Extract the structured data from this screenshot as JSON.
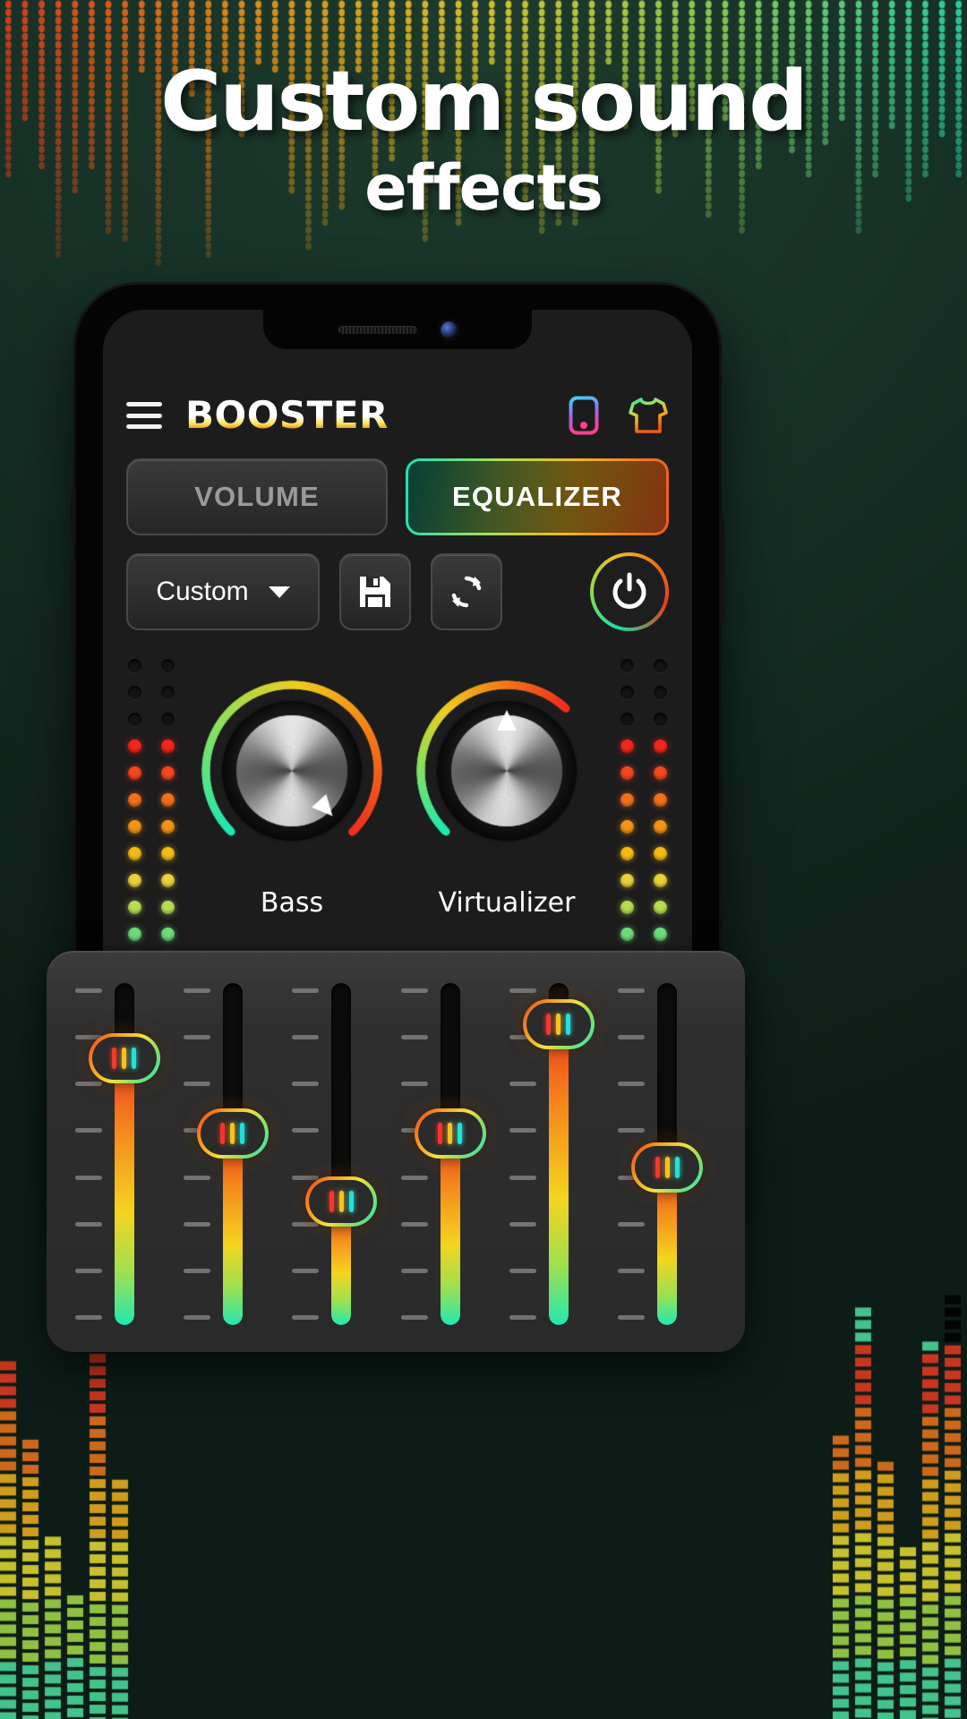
{
  "hero": {
    "line1": "Custom sound",
    "line2": "effects"
  },
  "app": {
    "brand": "BOOSTER",
    "menu_icon": "hamburger-menu-icon",
    "device_icon": "device-phone-icon",
    "theme_icon": "tshirt-theme-icon",
    "tabs": [
      {
        "label": "VOLUME",
        "active": false
      },
      {
        "label": "EQUALIZER",
        "active": true
      }
    ],
    "preset": {
      "value": "Custom",
      "caret_icon": "chevron-down-icon"
    },
    "actions": [
      {
        "name": "save-preset-button",
        "icon": "floppy-save-icon"
      },
      {
        "name": "reset-preset-button",
        "icon": "refresh-reset-icon"
      }
    ],
    "power": {
      "icon": "power-icon",
      "on": true
    },
    "knobs": [
      {
        "label": "Bass",
        "value": 78,
        "pointer_deg": 138
      },
      {
        "label": "Virtualizer",
        "value": 50,
        "pointer_deg": 0
      }
    ],
    "led_meters": {
      "off_count": 3,
      "on_colors": [
        "#f4261c",
        "#f4481c",
        "#f4701c",
        "#f59418",
        "#f5bb15",
        "#ead23a",
        "#b7dd52",
        "#6fe07d",
        "#38e6b2",
        "#16e8d8"
      ]
    },
    "equalizer": {
      "bands": [
        {
          "name": "band-1",
          "value": 78
        },
        {
          "name": "band-2",
          "value": 56
        },
        {
          "name": "band-3",
          "value": 36
        },
        {
          "name": "band-4",
          "value": 56
        },
        {
          "name": "band-5",
          "value": 88
        },
        {
          "name": "band-6",
          "value": 46
        }
      ],
      "tick_count": 8,
      "thumb_bar_colors": [
        "#f2382a",
        "#f5c21e",
        "#22e0d8"
      ]
    }
  },
  "colors": {
    "accent_cyan": "#16e0b8",
    "accent_green": "#a6e05a",
    "accent_yellow": "#f2b822",
    "accent_orange": "#f0581c",
    "accent_red": "#ea3b22",
    "panel_bg": "#2a2a2a",
    "screen_bg": "#1c1c1c",
    "hero_bg_top": "#1d3a2c"
  }
}
